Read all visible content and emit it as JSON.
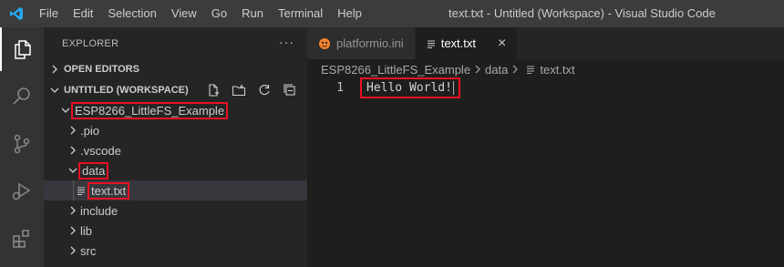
{
  "titlebar": {
    "menu": [
      "File",
      "Edit",
      "Selection",
      "View",
      "Go",
      "Run",
      "Terminal",
      "Help"
    ],
    "title": "text.txt - Untitled (Workspace) - Visual Studio Code"
  },
  "activitybar": {
    "icons": [
      "explorer-icon",
      "search-icon",
      "source-control-icon",
      "run-debug-icon",
      "extensions-icon"
    ]
  },
  "sidebar": {
    "header": "EXPLORER",
    "more": "···",
    "open_editors": "OPEN EDITORS",
    "workspace": "UNTITLED (WORKSPACE)",
    "tree": {
      "project": "ESP8266_LittleFS_Example",
      "pio": ".pio",
      "vscode": ".vscode",
      "data": "data",
      "file": "text.txt",
      "include": "include",
      "lib": "lib",
      "src": "src"
    }
  },
  "editor": {
    "tabs": [
      {
        "label": "platformio.ini",
        "icon": "platformio-icon"
      },
      {
        "label": "text.txt",
        "icon": "text-file-icon",
        "close": "×"
      }
    ],
    "breadcrumb": [
      "ESP8266_LittleFS_Example",
      "data",
      "text.txt"
    ],
    "lines": [
      {
        "number": "1",
        "text": "Hello World!"
      }
    ]
  },
  "colors": {
    "highlight": "#e81123",
    "accent_blue": "#23a8f2",
    "platformio_orange": "#f5822a"
  }
}
